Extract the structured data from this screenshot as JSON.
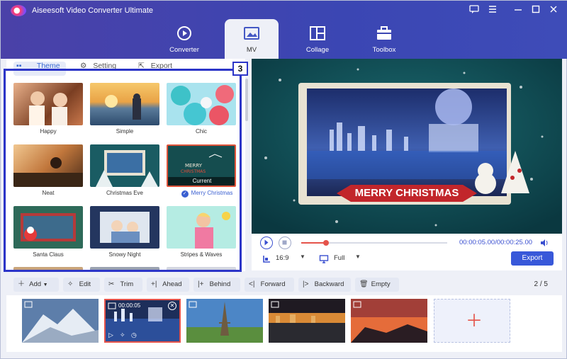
{
  "app": {
    "title": "Aiseesoft Video Converter Ultimate"
  },
  "nav": {
    "tabs": [
      {
        "label": "Converter"
      },
      {
        "label": "MV"
      },
      {
        "label": "Collage"
      },
      {
        "label": "Toolbox"
      }
    ]
  },
  "left_tabs": [
    {
      "label": "Theme"
    },
    {
      "label": "Setting"
    },
    {
      "label": "Export"
    }
  ],
  "step_badge": "3",
  "themes": [
    {
      "label": "Happy"
    },
    {
      "label": "Simple"
    },
    {
      "label": "Chic"
    },
    {
      "label": "Neat"
    },
    {
      "label": "Christmas Eve"
    },
    {
      "label": "Merry Christmas",
      "current_label": "Current"
    },
    {
      "label": "Santa Claus"
    },
    {
      "label": "Snowy Night"
    },
    {
      "label": "Stripes & Waves"
    }
  ],
  "preview": {
    "banner": "MERRY CHRISTMAS"
  },
  "playback": {
    "time_current": "00:00:05.00",
    "time_total": "00:00:25.00",
    "progress": 0.17,
    "aspect": "16:9",
    "view": "Full",
    "export_label": "Export"
  },
  "toolbar": {
    "add": "Add",
    "edit": "Edit",
    "trim": "Trim",
    "ahead": "Ahead",
    "behind": "Behind",
    "forward": "Forward",
    "backward": "Backward",
    "empty": "Empty",
    "page": "2 / 5"
  },
  "clips": {
    "selected_time": "00:00:05"
  },
  "colors": {
    "accent": "#3a4fd0",
    "highlight_border": "#2c35c8",
    "export_button": "#3858d9"
  }
}
